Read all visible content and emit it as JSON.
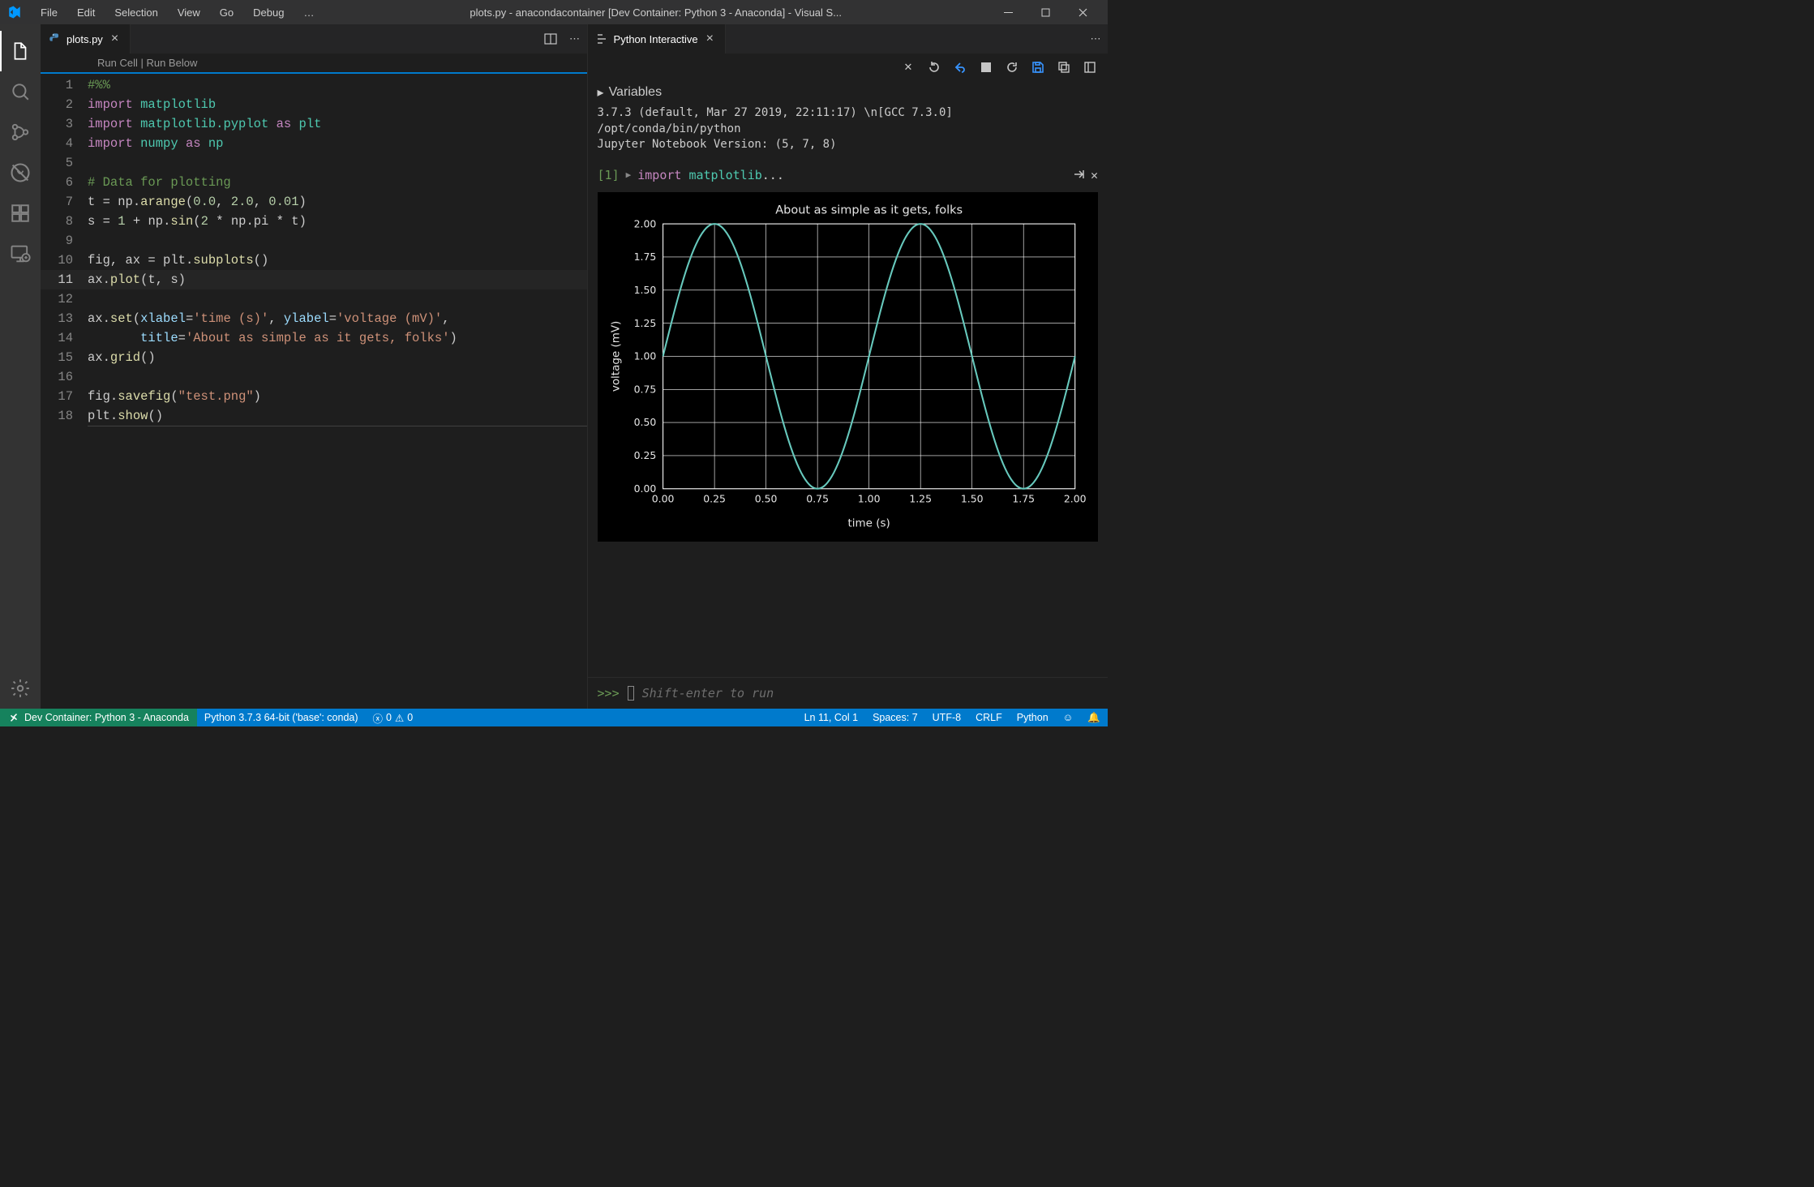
{
  "title": "plots.py - anacondacontainer [Dev Container: Python 3 - Anaconda] - Visual S...",
  "menu": [
    "File",
    "Edit",
    "Selection",
    "View",
    "Go",
    "Debug",
    "…"
  ],
  "tab_left": {
    "icon": "python",
    "label": "plots.py"
  },
  "codelens": {
    "run_cell": "Run Cell",
    "run_below": "Run Below",
    "sep": " | "
  },
  "code_lines": [
    {
      "n": "1",
      "html": "<span class='tok-cm'>#%%</span>"
    },
    {
      "n": "2",
      "html": "<span class='tok-kw'>import</span> <span class='tok-id'>matplotlib</span>"
    },
    {
      "n": "3",
      "html": "<span class='tok-kw'>import</span> <span class='tok-id'>matplotlib.pyplot</span> <span class='tok-kw'>as</span> <span class='tok-id'>plt</span>"
    },
    {
      "n": "4",
      "html": "<span class='tok-kw'>import</span> <span class='tok-id'>numpy</span> <span class='tok-kw'>as</span> <span class='tok-id'>np</span>"
    },
    {
      "n": "5",
      "html": ""
    },
    {
      "n": "6",
      "html": "<span class='tok-cm'># Data for plotting</span>"
    },
    {
      "n": "7",
      "html": "t <span class='tok-op'>=</span> np.<span class='tok-fn'>arange</span>(<span class='tok-nm'>0.0</span>, <span class='tok-nm'>2.0</span>, <span class='tok-nm'>0.01</span>)"
    },
    {
      "n": "8",
      "html": "s <span class='tok-op'>=</span> <span class='tok-nm'>1</span> <span class='tok-op'>+</span> np.<span class='tok-fn'>sin</span>(<span class='tok-nm'>2</span> <span class='tok-op'>*</span> np.pi <span class='tok-op'>*</span> t)"
    },
    {
      "n": "9",
      "html": ""
    },
    {
      "n": "10",
      "html": "fig, ax <span class='tok-op'>=</span> plt.<span class='tok-fn'>subplots</span>()"
    },
    {
      "n": "11",
      "html": "ax.<span class='tok-fn'>plot</span>(t, s)",
      "active": true
    },
    {
      "n": "12",
      "html": ""
    },
    {
      "n": "13",
      "html": "ax.<span class='tok-fn'>set</span>(<span class='tok-pa'>xlabel</span><span class='tok-op'>=</span><span class='tok-st'>'time (s)'</span>, <span class='tok-pa'>ylabel</span><span class='tok-op'>=</span><span class='tok-st'>'voltage (mV)'</span>,"
    },
    {
      "n": "14",
      "html": "       <span class='tok-pa'>title</span><span class='tok-op'>=</span><span class='tok-st'>'About as simple as it gets, folks'</span>)"
    },
    {
      "n": "15",
      "html": "ax.<span class='tok-fn'>grid</span>()"
    },
    {
      "n": "16",
      "html": ""
    },
    {
      "n": "17",
      "html": "fig.<span class='tok-fn'>savefig</span>(<span class='tok-st'>\"test.png\"</span>)"
    },
    {
      "n": "18",
      "html": "plt.<span class='tok-fn'>show</span>()"
    }
  ],
  "tab_right": {
    "label": "Python Interactive"
  },
  "variables_label": "Variables",
  "info_lines": [
    "3.7.3 (default, Mar 27 2019, 22:11:17) \\n[GCC 7.3.0]",
    "/opt/conda/bin/python",
    "Jupyter Notebook Version: (5, 7, 8)"
  ],
  "cell": {
    "index": "[1]",
    "code_html": "<span class='kw'>import</span> <span class='id'>matplotlib</span>..."
  },
  "repl": {
    "prompt": ">>>",
    "placeholder": "Shift-enter to run"
  },
  "status": {
    "remote": "Dev Container: Python 3 - Anaconda",
    "interpreter": "Python 3.7.3 64-bit ('base': conda)",
    "errors": "0",
    "warnings": "0",
    "cursor": "Ln 11, Col 1",
    "spaces": "Spaces: 7",
    "encoding": "UTF-8",
    "eol": "CRLF",
    "lang": "Python"
  },
  "chart_data": {
    "type": "line",
    "title": "About as simple as it gets, folks",
    "xlabel": "time (s)",
    "ylabel": "voltage (mV)",
    "xlim": [
      0.0,
      2.0
    ],
    "ylim": [
      0.0,
      2.0
    ],
    "xticks": [
      0.0,
      0.25,
      0.5,
      0.75,
      1.0,
      1.25,
      1.5,
      1.75,
      2.0
    ],
    "yticks": [
      0.0,
      0.25,
      0.5,
      0.75,
      1.0,
      1.25,
      1.5,
      1.75,
      2.0
    ],
    "grid": true,
    "series": [
      {
        "name": "s",
        "formula": "1 + sin(2*pi*t)",
        "t_start": 0.0,
        "t_end": 2.0,
        "t_step": 0.01,
        "color": "#67c9bd"
      }
    ]
  }
}
